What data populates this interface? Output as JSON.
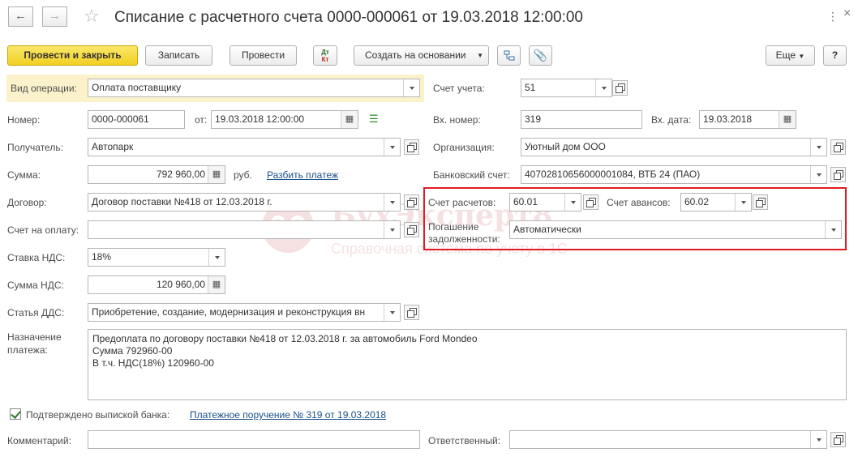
{
  "window": {
    "title": "Списание с расчетного счета 0000-000061 от 19.03.2018 12:00:00",
    "back_icon": "arrow-left-icon",
    "forward_icon": "arrow-right-icon",
    "favorite_icon": "star-icon"
  },
  "toolbar": {
    "post_close": "Провести и закрыть",
    "save": "Записать",
    "post": "Провести",
    "dtkt_top": "Дт",
    "dtkt_bottom": "Кт",
    "create_based": "Создать на основании",
    "more": "Еще",
    "help": "?"
  },
  "left": {
    "optype_label": "Вид операции:",
    "optype_value": "Оплата поставщику",
    "number_label": "Номер:",
    "number_value": "0000-000061",
    "date_label": "от:",
    "date_value": "19.03.2018 12:00:00",
    "recipient_label": "Получатель:",
    "recipient_value": "Автопарк",
    "sum_label": "Сумма:",
    "sum_value": "792 960,00",
    "currency": "руб.",
    "split_link": "Разбить платеж",
    "contract_label": "Договор:",
    "contract_value": "Договор поставки №418 от 12.03.2018 г.",
    "invoice_label": "Счет на оплату:",
    "invoice_value": "",
    "vat_rate_label": "Ставка НДС:",
    "vat_rate_value": "18%",
    "vat_sum_label": "Сумма НДС:",
    "vat_sum_value": "120 960,00",
    "dds_label": "Статья ДДС:",
    "dds_value": "Приобретение, создание, модернизация и реконструкция вн"
  },
  "right": {
    "account_label": "Счет учета:",
    "account_value": "51",
    "in_number_label": "Вх. номер:",
    "in_number_value": "319",
    "in_date_label": "Вх. дата:",
    "in_date_value": "19.03.2018",
    "org_label": "Организация:",
    "org_value": "Уютный дом ООО",
    "bank_label": "Банковский счет:",
    "bank_value": "40702810656000001084, ВТБ 24 (ПАО)",
    "settle_label": "Счет расчетов:",
    "settle_value": "60.01",
    "advance_label": "Счет авансов:",
    "advance_value": "60.02",
    "debt_label_1": "Погашение",
    "debt_label_2": "задолженности:",
    "debt_value": "Автоматически"
  },
  "purpose": {
    "label_1": "Назначение",
    "label_2": "платежа:",
    "line1": "Предоплата по договору поставки №418 от 12.03.2018 г. за автомобиль Ford Mondeo",
    "line2": "Сумма 792960-00",
    "line3": "В т.ч. НДС(18%) 120960-00"
  },
  "bottom": {
    "confirmed_label": "Подтверждено выпиской банка:",
    "confirmed_checked": true,
    "payment_order_link": "Платежное поручение № 319 от 19.03.2018",
    "comment_label": "Комментарий:",
    "comment_value": "",
    "responsible_label": "Ответственный:",
    "responsible_value": ""
  },
  "watermark": {
    "brand": "БухЭксперт8",
    "subtitle": "Справочная система по учету в 1С"
  },
  "colors": {
    "primary_button": "#f1cf22",
    "highlight_row": "#fbf2cc",
    "red_frame": "#e01b22",
    "link": "#1a4f8a"
  }
}
